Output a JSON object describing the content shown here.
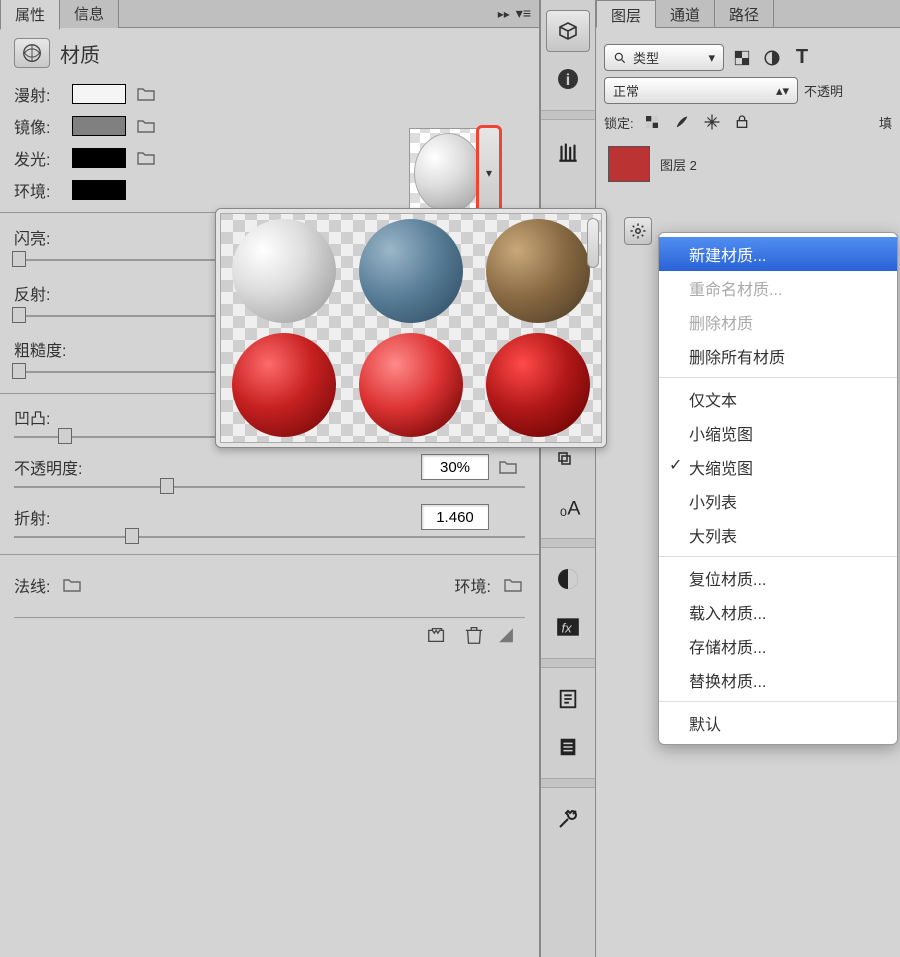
{
  "tabs": {
    "properties": "属性",
    "info": "信息"
  },
  "section": {
    "title": "材质"
  },
  "props": {
    "diffuse": {
      "label": "漫射:",
      "color": "#f5f5f5"
    },
    "specular": {
      "label": "镜像:",
      "color": "#808080"
    },
    "emissive": {
      "label": "发光:",
      "color": "#000000"
    },
    "ambient": {
      "label": "环境:",
      "color": "#000000"
    }
  },
  "sliders": {
    "shiny": {
      "label": "闪亮:"
    },
    "reflect": {
      "label": "反射:"
    },
    "rough": {
      "label": "粗糙度:"
    }
  },
  "values": {
    "bump": {
      "label": "凹凸:",
      "value": "10%"
    },
    "opacity": {
      "label": "不透明度:",
      "value": "30%"
    },
    "refract": {
      "label": "折射:",
      "value": "1.460"
    }
  },
  "bottom": {
    "normal": "法线:",
    "env": "环境:"
  },
  "layers": {
    "tabs": {
      "layers": "图层",
      "channels": "通道",
      "paths": "路径"
    },
    "kind": "类型",
    "blend": "正常",
    "opacity_label": "不透明",
    "lock_label": "锁定:",
    "fill_label": "填",
    "item": "图层 2"
  },
  "menu": {
    "new": "新建材质...",
    "rename": "重命名材质...",
    "delete": "删除材质",
    "delete_all": "删除所有材质",
    "text_only": "仅文本",
    "small_thumb": "小缩览图",
    "large_thumb": "大缩览图",
    "small_list": "小列表",
    "large_list": "大列表",
    "reset": "复位材质...",
    "load": "载入材质...",
    "save": "存储材质...",
    "replace": "替换材质...",
    "default": "默认"
  }
}
